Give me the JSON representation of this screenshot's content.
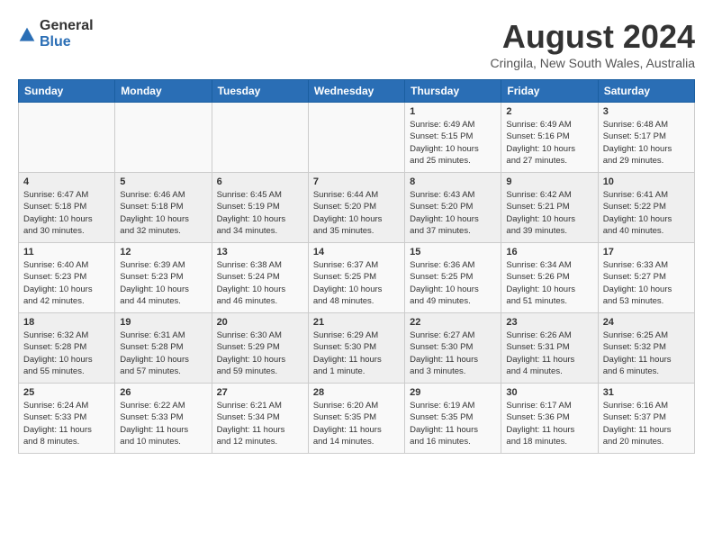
{
  "header": {
    "logo_general": "General",
    "logo_blue": "Blue",
    "month_year": "August 2024",
    "location": "Cringila, New South Wales, Australia"
  },
  "calendar": {
    "days_of_week": [
      "Sunday",
      "Monday",
      "Tuesday",
      "Wednesday",
      "Thursday",
      "Friday",
      "Saturday"
    ],
    "weeks": [
      [
        {
          "day": "",
          "info": ""
        },
        {
          "day": "",
          "info": ""
        },
        {
          "day": "",
          "info": ""
        },
        {
          "day": "",
          "info": ""
        },
        {
          "day": "1",
          "info": "Sunrise: 6:49 AM\nSunset: 5:15 PM\nDaylight: 10 hours\nand 25 minutes."
        },
        {
          "day": "2",
          "info": "Sunrise: 6:49 AM\nSunset: 5:16 PM\nDaylight: 10 hours\nand 27 minutes."
        },
        {
          "day": "3",
          "info": "Sunrise: 6:48 AM\nSunset: 5:17 PM\nDaylight: 10 hours\nand 29 minutes."
        }
      ],
      [
        {
          "day": "4",
          "info": "Sunrise: 6:47 AM\nSunset: 5:18 PM\nDaylight: 10 hours\nand 30 minutes."
        },
        {
          "day": "5",
          "info": "Sunrise: 6:46 AM\nSunset: 5:18 PM\nDaylight: 10 hours\nand 32 minutes."
        },
        {
          "day": "6",
          "info": "Sunrise: 6:45 AM\nSunset: 5:19 PM\nDaylight: 10 hours\nand 34 minutes."
        },
        {
          "day": "7",
          "info": "Sunrise: 6:44 AM\nSunset: 5:20 PM\nDaylight: 10 hours\nand 35 minutes."
        },
        {
          "day": "8",
          "info": "Sunrise: 6:43 AM\nSunset: 5:20 PM\nDaylight: 10 hours\nand 37 minutes."
        },
        {
          "day": "9",
          "info": "Sunrise: 6:42 AM\nSunset: 5:21 PM\nDaylight: 10 hours\nand 39 minutes."
        },
        {
          "day": "10",
          "info": "Sunrise: 6:41 AM\nSunset: 5:22 PM\nDaylight: 10 hours\nand 40 minutes."
        }
      ],
      [
        {
          "day": "11",
          "info": "Sunrise: 6:40 AM\nSunset: 5:23 PM\nDaylight: 10 hours\nand 42 minutes."
        },
        {
          "day": "12",
          "info": "Sunrise: 6:39 AM\nSunset: 5:23 PM\nDaylight: 10 hours\nand 44 minutes."
        },
        {
          "day": "13",
          "info": "Sunrise: 6:38 AM\nSunset: 5:24 PM\nDaylight: 10 hours\nand 46 minutes."
        },
        {
          "day": "14",
          "info": "Sunrise: 6:37 AM\nSunset: 5:25 PM\nDaylight: 10 hours\nand 48 minutes."
        },
        {
          "day": "15",
          "info": "Sunrise: 6:36 AM\nSunset: 5:25 PM\nDaylight: 10 hours\nand 49 minutes."
        },
        {
          "day": "16",
          "info": "Sunrise: 6:34 AM\nSunset: 5:26 PM\nDaylight: 10 hours\nand 51 minutes."
        },
        {
          "day": "17",
          "info": "Sunrise: 6:33 AM\nSunset: 5:27 PM\nDaylight: 10 hours\nand 53 minutes."
        }
      ],
      [
        {
          "day": "18",
          "info": "Sunrise: 6:32 AM\nSunset: 5:28 PM\nDaylight: 10 hours\nand 55 minutes."
        },
        {
          "day": "19",
          "info": "Sunrise: 6:31 AM\nSunset: 5:28 PM\nDaylight: 10 hours\nand 57 minutes."
        },
        {
          "day": "20",
          "info": "Sunrise: 6:30 AM\nSunset: 5:29 PM\nDaylight: 10 hours\nand 59 minutes."
        },
        {
          "day": "21",
          "info": "Sunrise: 6:29 AM\nSunset: 5:30 PM\nDaylight: 11 hours\nand 1 minute."
        },
        {
          "day": "22",
          "info": "Sunrise: 6:27 AM\nSunset: 5:30 PM\nDaylight: 11 hours\nand 3 minutes."
        },
        {
          "day": "23",
          "info": "Sunrise: 6:26 AM\nSunset: 5:31 PM\nDaylight: 11 hours\nand 4 minutes."
        },
        {
          "day": "24",
          "info": "Sunrise: 6:25 AM\nSunset: 5:32 PM\nDaylight: 11 hours\nand 6 minutes."
        }
      ],
      [
        {
          "day": "25",
          "info": "Sunrise: 6:24 AM\nSunset: 5:33 PM\nDaylight: 11 hours\nand 8 minutes."
        },
        {
          "day": "26",
          "info": "Sunrise: 6:22 AM\nSunset: 5:33 PM\nDaylight: 11 hours\nand 10 minutes."
        },
        {
          "day": "27",
          "info": "Sunrise: 6:21 AM\nSunset: 5:34 PM\nDaylight: 11 hours\nand 12 minutes."
        },
        {
          "day": "28",
          "info": "Sunrise: 6:20 AM\nSunset: 5:35 PM\nDaylight: 11 hours\nand 14 minutes."
        },
        {
          "day": "29",
          "info": "Sunrise: 6:19 AM\nSunset: 5:35 PM\nDaylight: 11 hours\nand 16 minutes."
        },
        {
          "day": "30",
          "info": "Sunrise: 6:17 AM\nSunset: 5:36 PM\nDaylight: 11 hours\nand 18 minutes."
        },
        {
          "day": "31",
          "info": "Sunrise: 6:16 AM\nSunset: 5:37 PM\nDaylight: 11 hours\nand 20 minutes."
        }
      ]
    ]
  }
}
